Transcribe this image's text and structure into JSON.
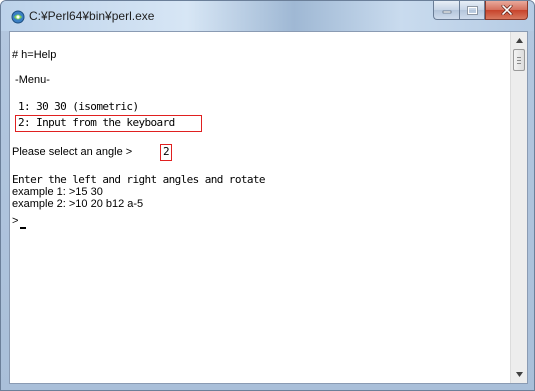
{
  "window": {
    "title": "C:¥Perl64¥bin¥perl.exe",
    "icon": "perl-console-icon",
    "buttons": [
      "minimize-button",
      "maximize-button",
      "close-button"
    ]
  },
  "console": {
    "lines": {
      "help": "# h=Help",
      "menu": " -Menu-",
      "option1": " 1: 30 30 (isometric)",
      "option2": " 2: Input from the keyboard",
      "select_prompt": "Please select an angle >",
      "select_input": "2",
      "instruction": "Enter the left and right angles and rotate",
      "example1": "example 1: >15 30",
      "example2": "example 2: >10 20 b12 a-5",
      "prompt": ">"
    },
    "highlight_color": "#e02020"
  }
}
